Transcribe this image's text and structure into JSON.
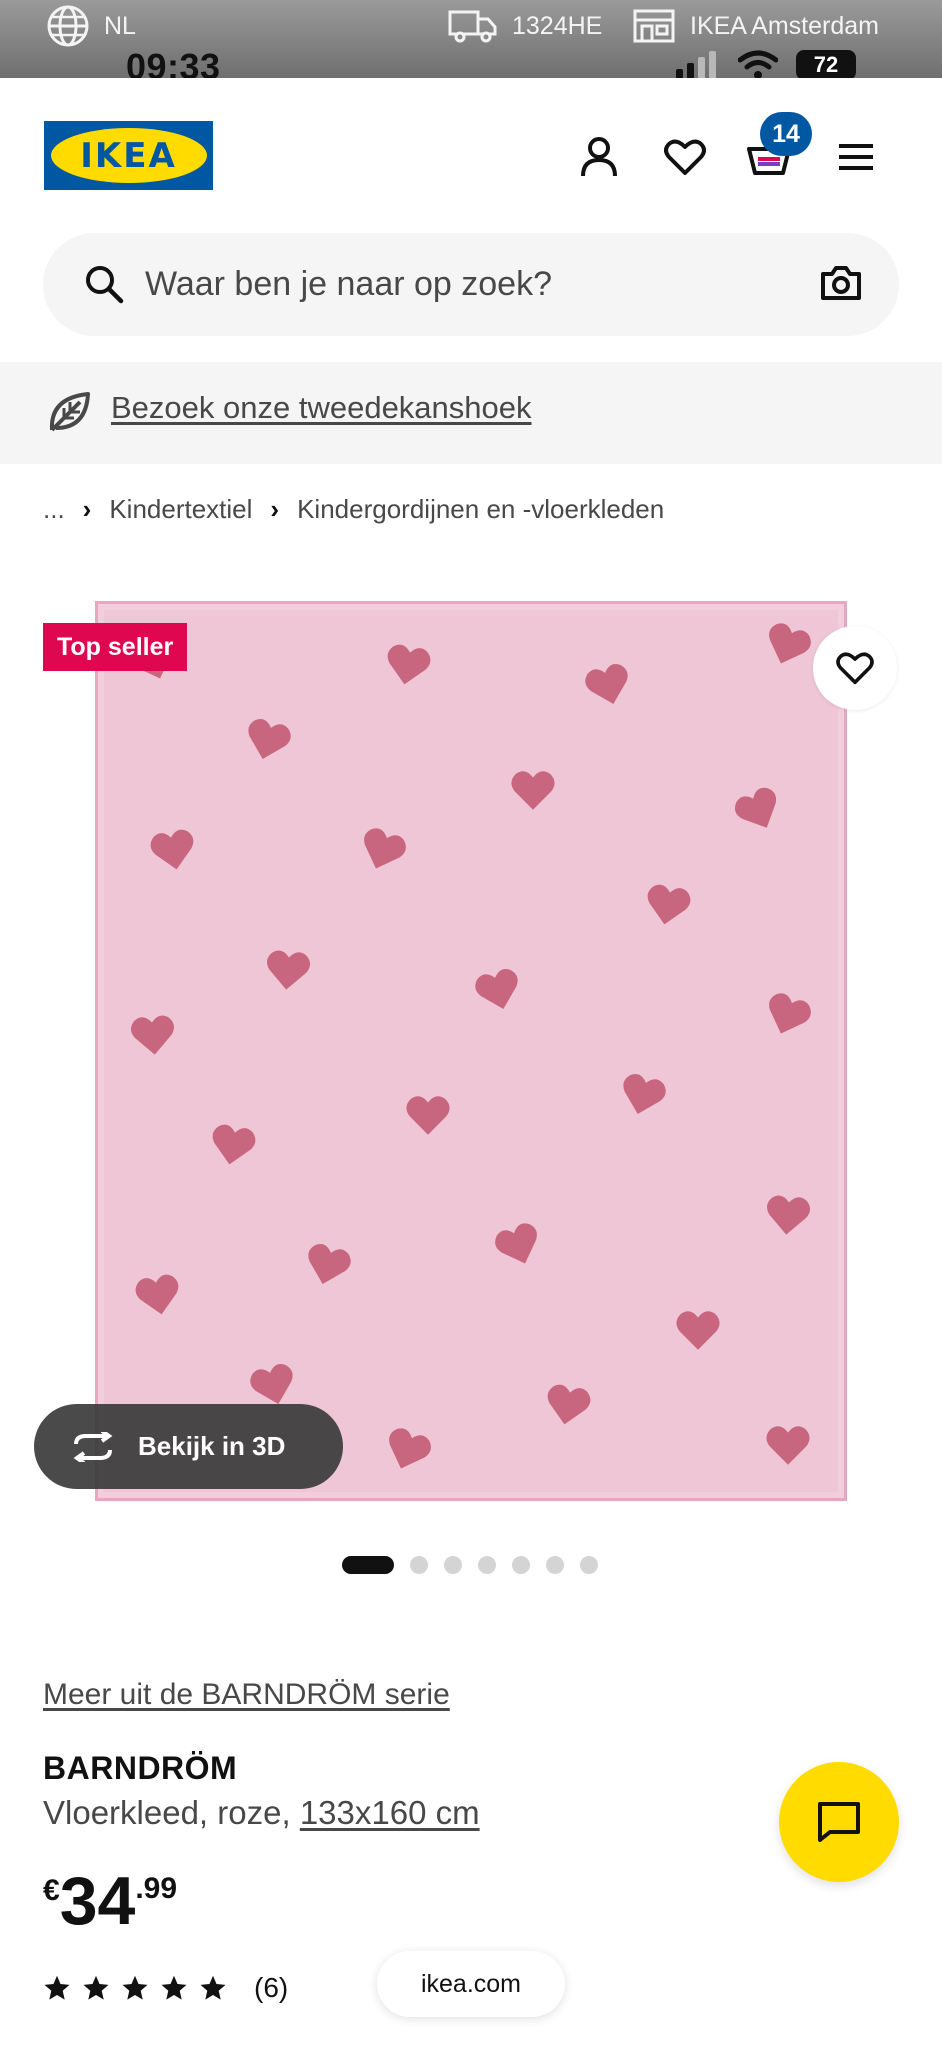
{
  "top_strip": {
    "language": "NL",
    "postcode": "1324HE",
    "store": "IKEA Amsterdam"
  },
  "status_bar": {
    "time": "09:33",
    "battery": "72"
  },
  "header": {
    "logo_text": "IKEA",
    "cart_count": "14"
  },
  "search": {
    "placeholder": "Waar ben je naar op zoek?"
  },
  "promo": {
    "link": "Bezoek onze tweedekanshoek"
  },
  "breadcrumb": {
    "ellipsis": "...",
    "items": [
      "Kindertextiel",
      "Kindergordijnen en -vloerkleden"
    ]
  },
  "product": {
    "badge": "Top seller",
    "view3d_label": "Bekijk in 3D",
    "image_count": 7,
    "active_image": 1,
    "series_link": "Meer uit de BARNDRÖM serie",
    "name": "BARNDRÖM",
    "description": "Vloerkleed, roze, ",
    "size": "133x160 cm",
    "price_currency": "€",
    "price_integer": "34",
    "price_decimal": ".99",
    "rating_stars": 5,
    "review_count": "(6)"
  },
  "browser": {
    "url": "ikea.com"
  },
  "colors": {
    "ikea_blue": "#0058a3",
    "ikea_yellow": "#ffdb00",
    "badge_red": "#e00751",
    "rug_pink": "#efc6d6",
    "heart_pink": "#c9667f"
  }
}
